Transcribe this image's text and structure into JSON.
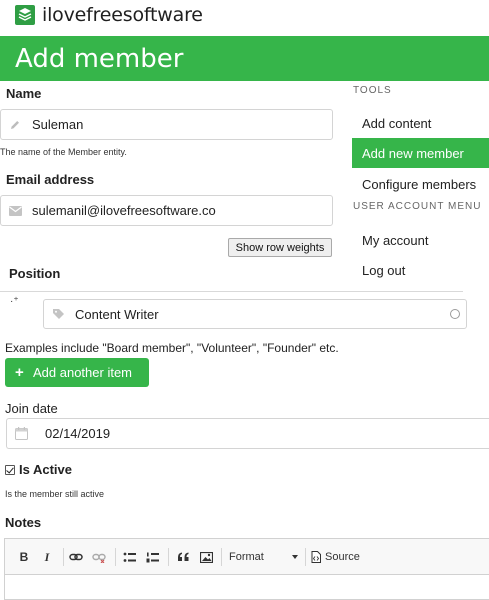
{
  "brand": {
    "name": "ilovefreesoftware",
    "icon": "books-logo-icon"
  },
  "page": {
    "title": "Add member",
    "accent_color": "#36b54a"
  },
  "form": {
    "name": {
      "label": "Name",
      "value": "Suleman",
      "icon": "pencil-icon",
      "description": "The name of the Member entity."
    },
    "email": {
      "label": "Email address",
      "value": "sulemanil@ilovefreesoftware.co",
      "icon": "envelope-icon"
    },
    "row_weights_button": "Show row weights",
    "position": {
      "label": "Position",
      "drag_handle": "·⁺",
      "value": "Content Writer",
      "icon": "tag-icon",
      "examples": "Examples include \"Board member\", \"Volunteer\", \"Founder\" etc.",
      "add_button": "Add another item"
    },
    "join_date": {
      "label": "Join date",
      "value": "02/14/2019",
      "icon": "calendar-icon"
    },
    "is_active": {
      "label": "Is Active",
      "checked": true,
      "description": "Is the member still active"
    },
    "notes": {
      "label": "Notes",
      "toolbar": {
        "bold": "B",
        "italic": "I",
        "format": "Format",
        "source": "Source",
        "icons": [
          "link-icon",
          "unlink-icon",
          "bulleted-list-icon",
          "numbered-list-icon",
          "blockquote-icon",
          "image-icon",
          "source-icon"
        ]
      }
    }
  },
  "sidebar": {
    "tools_heading": "TOOLS",
    "tools": [
      {
        "label": "Add content",
        "active": false
      },
      {
        "label": "Add new member",
        "active": true
      },
      {
        "label": "Configure members",
        "active": false
      }
    ],
    "account_heading": "USER ACCOUNT MENU",
    "account": [
      {
        "label": "My account"
      },
      {
        "label": "Log out"
      }
    ]
  }
}
